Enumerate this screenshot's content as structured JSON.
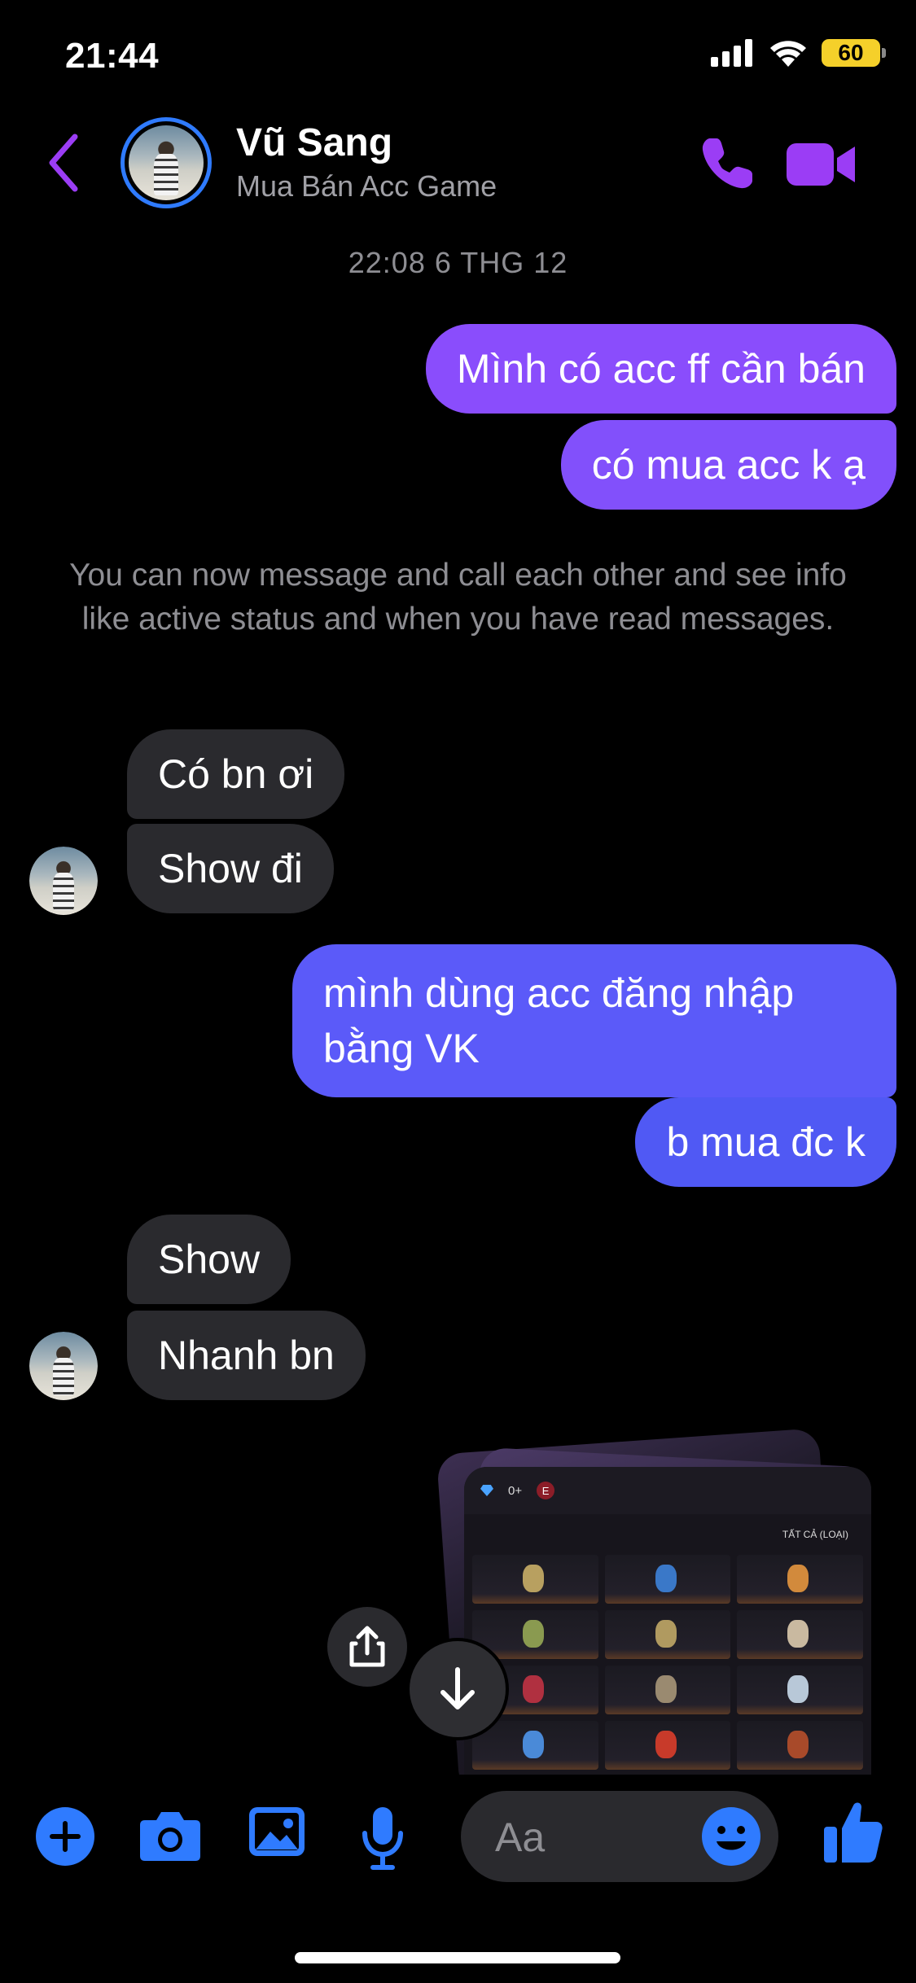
{
  "status_bar": {
    "time": "21:44",
    "battery": "60",
    "icons": [
      "signal-icon",
      "wifi-icon",
      "battery-icon"
    ]
  },
  "header": {
    "back_icon": "chevron-left-icon",
    "name": "Vũ Sang",
    "subtitle": "Mua Bán Acc Game",
    "call_icon": "phone-icon",
    "video_icon": "video-camera-icon",
    "accent": "#9b3df5"
  },
  "conversation": {
    "timestamp": "22:08 6 THG 12",
    "system_note": "You can now message and call each other and see info like active status and when you have read messages.",
    "messages": [
      {
        "from": "me",
        "text": "Mình có acc ff cần bán"
      },
      {
        "from": "me",
        "text": "có mua acc k ạ"
      },
      {
        "from": "them",
        "text": "Có bn ơi"
      },
      {
        "from": "them",
        "text": "Show đi"
      },
      {
        "from": "me",
        "text": "mình dùng acc đăng nhập bằng VK"
      },
      {
        "from": "me",
        "text": "b mua đc k"
      },
      {
        "from": "them",
        "text": "Show"
      },
      {
        "from": "them",
        "text": "Nhanh bn"
      }
    ],
    "image_stack": {
      "top_bar_left": "0+",
      "tag": "E",
      "label": "TẤT CẢ (LOẠI)"
    }
  },
  "composer": {
    "placeholder": "Aa",
    "icons": [
      "plus-icon",
      "camera-icon",
      "photo-icon",
      "microphone-icon",
      "emoji-icon",
      "thumbs-up-icon"
    ],
    "accent": "#2f7bff"
  }
}
